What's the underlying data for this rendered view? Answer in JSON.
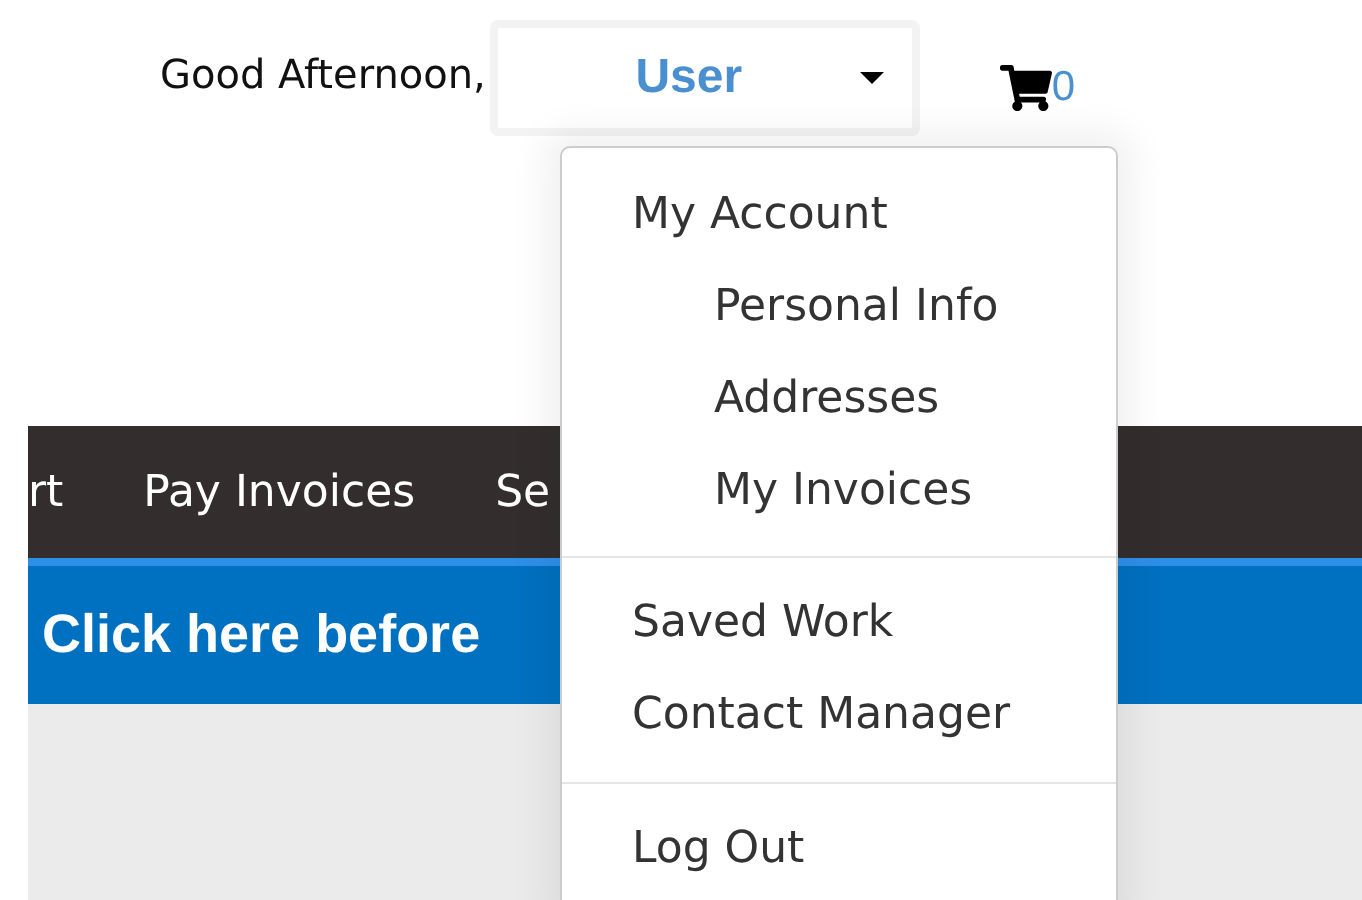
{
  "header": {
    "greeting": "Good Afternoon,",
    "user_button": "User",
    "cart_count": "0"
  },
  "nav": {
    "items": [
      {
        "label": "rt"
      },
      {
        "label": "Pay Invoices"
      },
      {
        "label": "Se"
      }
    ]
  },
  "banner": {
    "text": "Click here before"
  },
  "user_menu": {
    "groups": [
      {
        "items": [
          {
            "label": "My Account",
            "children": [
              {
                "label": "Personal Info"
              },
              {
                "label": "Addresses"
              },
              {
                "label": "My Invoices"
              }
            ]
          }
        ]
      },
      {
        "items": [
          {
            "label": "Saved Work"
          },
          {
            "label": "Contact Manager"
          }
        ]
      },
      {
        "items": [
          {
            "label": "Log Out"
          }
        ]
      }
    ]
  }
}
